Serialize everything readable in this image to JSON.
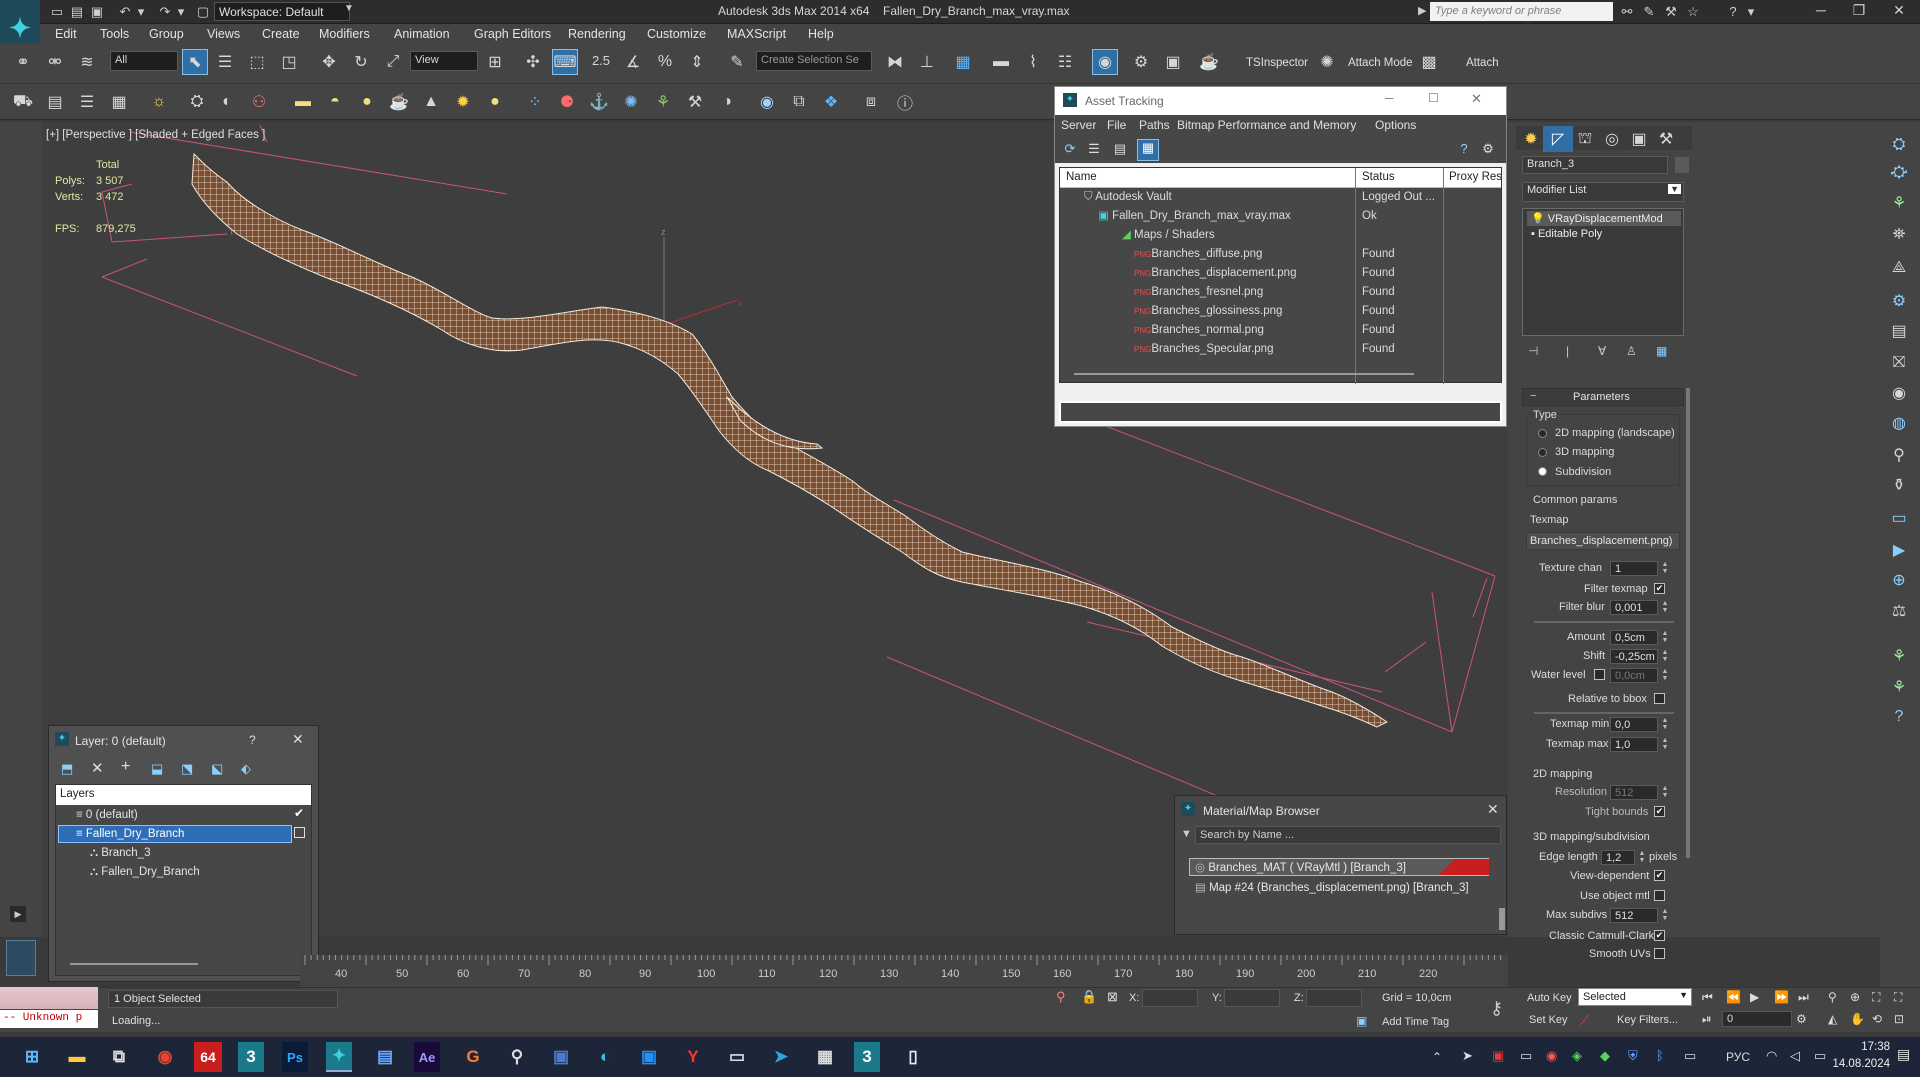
{
  "titlebar": {
    "workspace": "Workspace: Default",
    "app_title": "Autodesk 3ds Max  2014 x64",
    "doc_title": "Fallen_Dry_Branch_max_vray.max",
    "search_placeholder": "Type a keyword or phrase"
  },
  "menu": [
    "Edit",
    "Tools",
    "Group",
    "Views",
    "Create",
    "Modifiers",
    "Animation",
    "Graph Editors",
    "Rendering",
    "Customize",
    "MAXScript",
    "Help"
  ],
  "toolbar": {
    "selection_filter": "All",
    "ref_coord": "View",
    "snap_value": "2.5",
    "named_selection": "Create Selection Se",
    "tsinspector": "TSInspector",
    "attach_mode": "Attach Mode",
    "attach": "Attach"
  },
  "viewport": {
    "label": "[+] [Perspective ] [Shaded + Edged Faces ]",
    "stats_total": "Total",
    "polys_label": "Polys:",
    "polys_value": "3 507",
    "verts_label": "Verts:",
    "verts_value": "3 472",
    "fps_label": "FPS:",
    "fps_value": "879,275",
    "gizmo_z": "z",
    "gizmo_x": "x"
  },
  "asset_tracking": {
    "title": "Asset Tracking",
    "menu": [
      "Server",
      "File",
      "Paths",
      "Bitmap Performance and Memory",
      "Options"
    ],
    "columns": [
      "Name",
      "Status",
      "Proxy Reso"
    ],
    "rows": [
      {
        "name": "Autodesk Vault",
        "status": "Logged Out ...",
        "indent": 0
      },
      {
        "name": "Fallen_Dry_Branch_max_vray.max",
        "status": "Ok",
        "indent": 1
      },
      {
        "name": "Maps / Shaders",
        "status": "",
        "indent": 2
      },
      {
        "name": "Branches_diffuse.png",
        "status": "Found",
        "indent": 3
      },
      {
        "name": "Branches_displacement.png",
        "status": "Found",
        "indent": 3
      },
      {
        "name": "Branches_fresnel.png",
        "status": "Found",
        "indent": 3
      },
      {
        "name": "Branches_glossiness.png",
        "status": "Found",
        "indent": 3
      },
      {
        "name": "Branches_normal.png",
        "status": "Found",
        "indent": 3
      },
      {
        "name": "Branches_Specular.png",
        "status": "Found",
        "indent": 3
      }
    ]
  },
  "layer_panel": {
    "title": "Layer: 0 (default)",
    "help": "?",
    "header": "Layers",
    "items": [
      {
        "label": "0 (default)",
        "indent": 1
      },
      {
        "label": "Fallen_Dry_Branch",
        "indent": 1
      },
      {
        "label": "Branch_3",
        "indent": 2
      },
      {
        "label": "Fallen_Dry_Branch",
        "indent": 2
      }
    ]
  },
  "material_browser": {
    "title": "Material/Map Browser",
    "search_placeholder": "Search by Name ...",
    "items": [
      "Branches_MAT ( VRayMtl ) [Branch_3]",
      "Map #24 (Branches_displacement.png) [Branch_3]"
    ]
  },
  "command_panel": {
    "object_name": "Branch_3",
    "modifier_list": "Modifier List",
    "stack": [
      "VRayDisplacementMod",
      "Editable Poly"
    ],
    "rollout_title": "Parameters",
    "type_label": "Type",
    "type_options": [
      "2D mapping (landscape)",
      "3D mapping",
      "Subdivision"
    ],
    "common_params": "Common params",
    "texmap_label": "Texmap",
    "texmap_value": "Branches_displacement.png)",
    "texture_chan_label": "Texture chan",
    "texture_chan_value": "1",
    "filter_texmap": "Filter texmap",
    "filter_blur_label": "Filter blur",
    "filter_blur_value": "0,001",
    "amount_label": "Amount",
    "amount_value": "0,5cm",
    "shift_label": "Shift",
    "shift_value": "-0,25cm",
    "water_level_label": "Water level",
    "water_level_value": "0,0cm",
    "relative_bbox": "Relative to bbox",
    "texmap_min_label": "Texmap min",
    "texmap_min_value": "0,0",
    "texmap_max_label": "Texmap max",
    "texmap_max_value": "1,0",
    "mapping2d": "2D mapping",
    "resolution_label": "Resolution",
    "resolution_value": "512",
    "tight_bounds": "Tight bounds",
    "mapping3d": "3D mapping/subdivision",
    "edge_length_label": "Edge length",
    "edge_length_value": "1,2",
    "pixels": "pixels",
    "view_dependent": "View-dependent",
    "use_object_mtl": "Use object mtl",
    "max_subdivs_label": "Max subdivs",
    "max_subdivs_value": "512",
    "classic_catmull": "Classic Catmull-Clark",
    "smooth_uvs": "Smooth UVs"
  },
  "timeline": {
    "ticks": [
      "40",
      "50",
      "60",
      "70",
      "80",
      "90",
      "100",
      "110",
      "120",
      "130",
      "140",
      "150",
      "160",
      "170",
      "180",
      "190",
      "200",
      "210",
      "220"
    ]
  },
  "status": {
    "script_error": "-- Unknown p",
    "objects_selected": "1 Object Selected",
    "loading": "Loading...",
    "x_label": "X:",
    "y_label": "Y:",
    "z_label": "Z:",
    "grid": "Grid = 10,0cm",
    "add_time_tag": "Add Time Tag",
    "auto_key": "Auto Key",
    "set_key": "Set Key",
    "selected": "Selected",
    "key_filters": "Key Filters...",
    "frame": "0"
  },
  "taskbar": {
    "lang": "РУС",
    "time": "17:38",
    "date": "14.08.2024",
    "badge": "64"
  },
  "colors": {
    "accent_blue": "#2f6fa5",
    "wire": "#f2e9dc",
    "mesh": "#8a5a3a",
    "bbox": "#d05a7c"
  }
}
